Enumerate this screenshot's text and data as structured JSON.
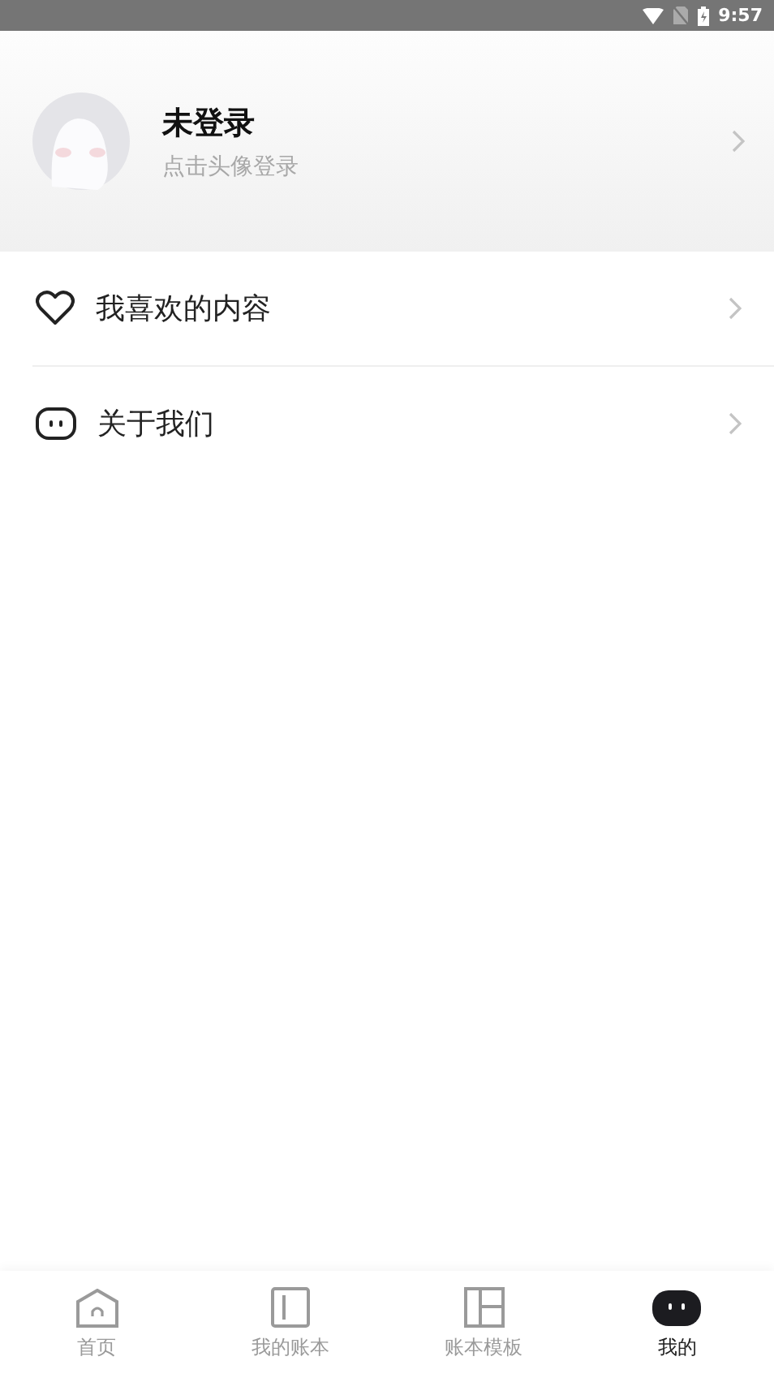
{
  "status_bar": {
    "time": "9:57"
  },
  "profile": {
    "name": "未登录",
    "hint": "点击头像登录"
  },
  "menu": [
    {
      "kind": "heart",
      "label": "我喜欢的内容"
    },
    {
      "kind": "about",
      "label": "关于我们"
    }
  ],
  "tabs": [
    {
      "kind": "home",
      "label": "首页",
      "selected": false
    },
    {
      "kind": "book",
      "label": "我的账本",
      "selected": false
    },
    {
      "kind": "template",
      "label": "账本模板",
      "selected": false
    },
    {
      "kind": "me",
      "label": "我的",
      "selected": true
    }
  ]
}
